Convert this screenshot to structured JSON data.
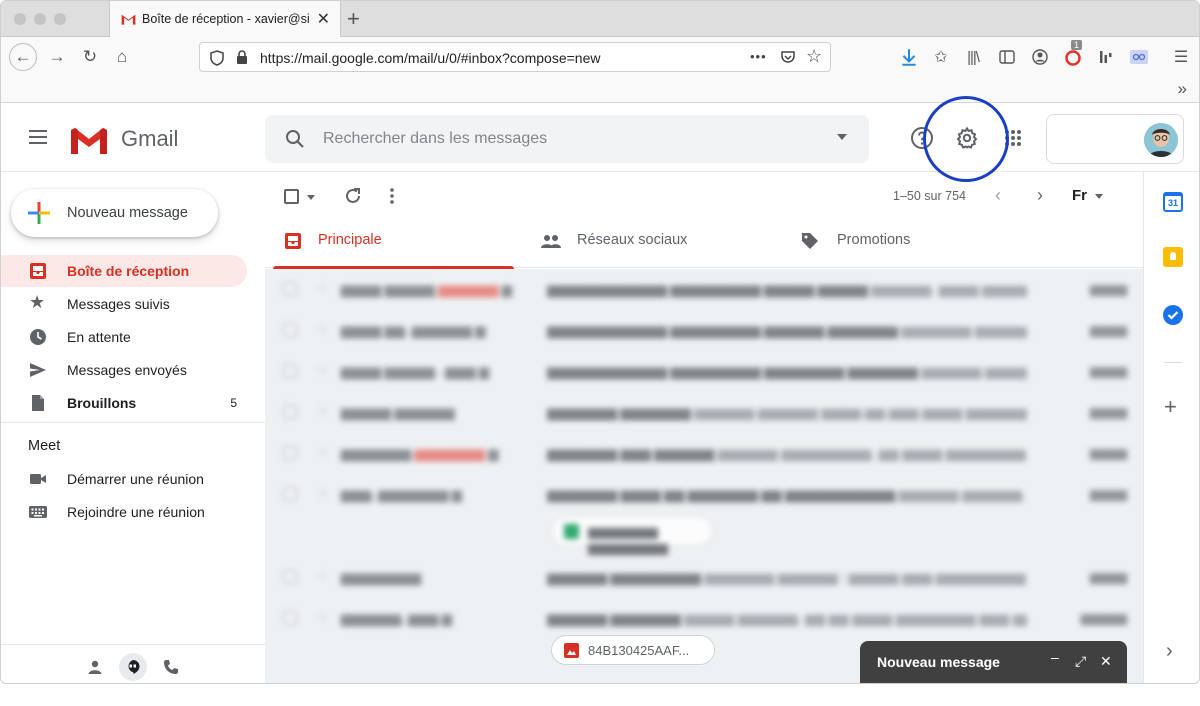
{
  "browser": {
    "tab_title": "Boîte de réception - xavier@sig",
    "url": "https://mail.google.com/mail/u/0/#inbox?compose=new",
    "url_more": "•••",
    "notification_badge": "1"
  },
  "gmail": {
    "logo_text": "Gmail",
    "search_placeholder": "Rechercher dans les messages",
    "compose_label": "Nouveau message",
    "nav": [
      {
        "label": "Boîte de réception",
        "active": true
      },
      {
        "label": "Messages suivis"
      },
      {
        "label": "En attente"
      },
      {
        "label": "Messages envoyés"
      },
      {
        "label": "Brouillons",
        "count": "5"
      }
    ],
    "meet": {
      "title": "Meet",
      "items": [
        {
          "label": "Démarrer une réunion"
        },
        {
          "label": "Rejoindre une réunion"
        }
      ]
    },
    "pager": "1–50 sur 754",
    "lang_button": "Fr",
    "tabs": [
      {
        "label": "Principale",
        "active": true
      },
      {
        "label": "Réseaux sociaux"
      },
      {
        "label": "Promotions"
      }
    ],
    "attachment_chip": "84B130425AAF...",
    "compose_window_title": "Nouveau message"
  },
  "colors": {
    "accent_red": "#d93025",
    "highlight_ring": "#1a3fc4",
    "compose_bg": "#404040"
  }
}
